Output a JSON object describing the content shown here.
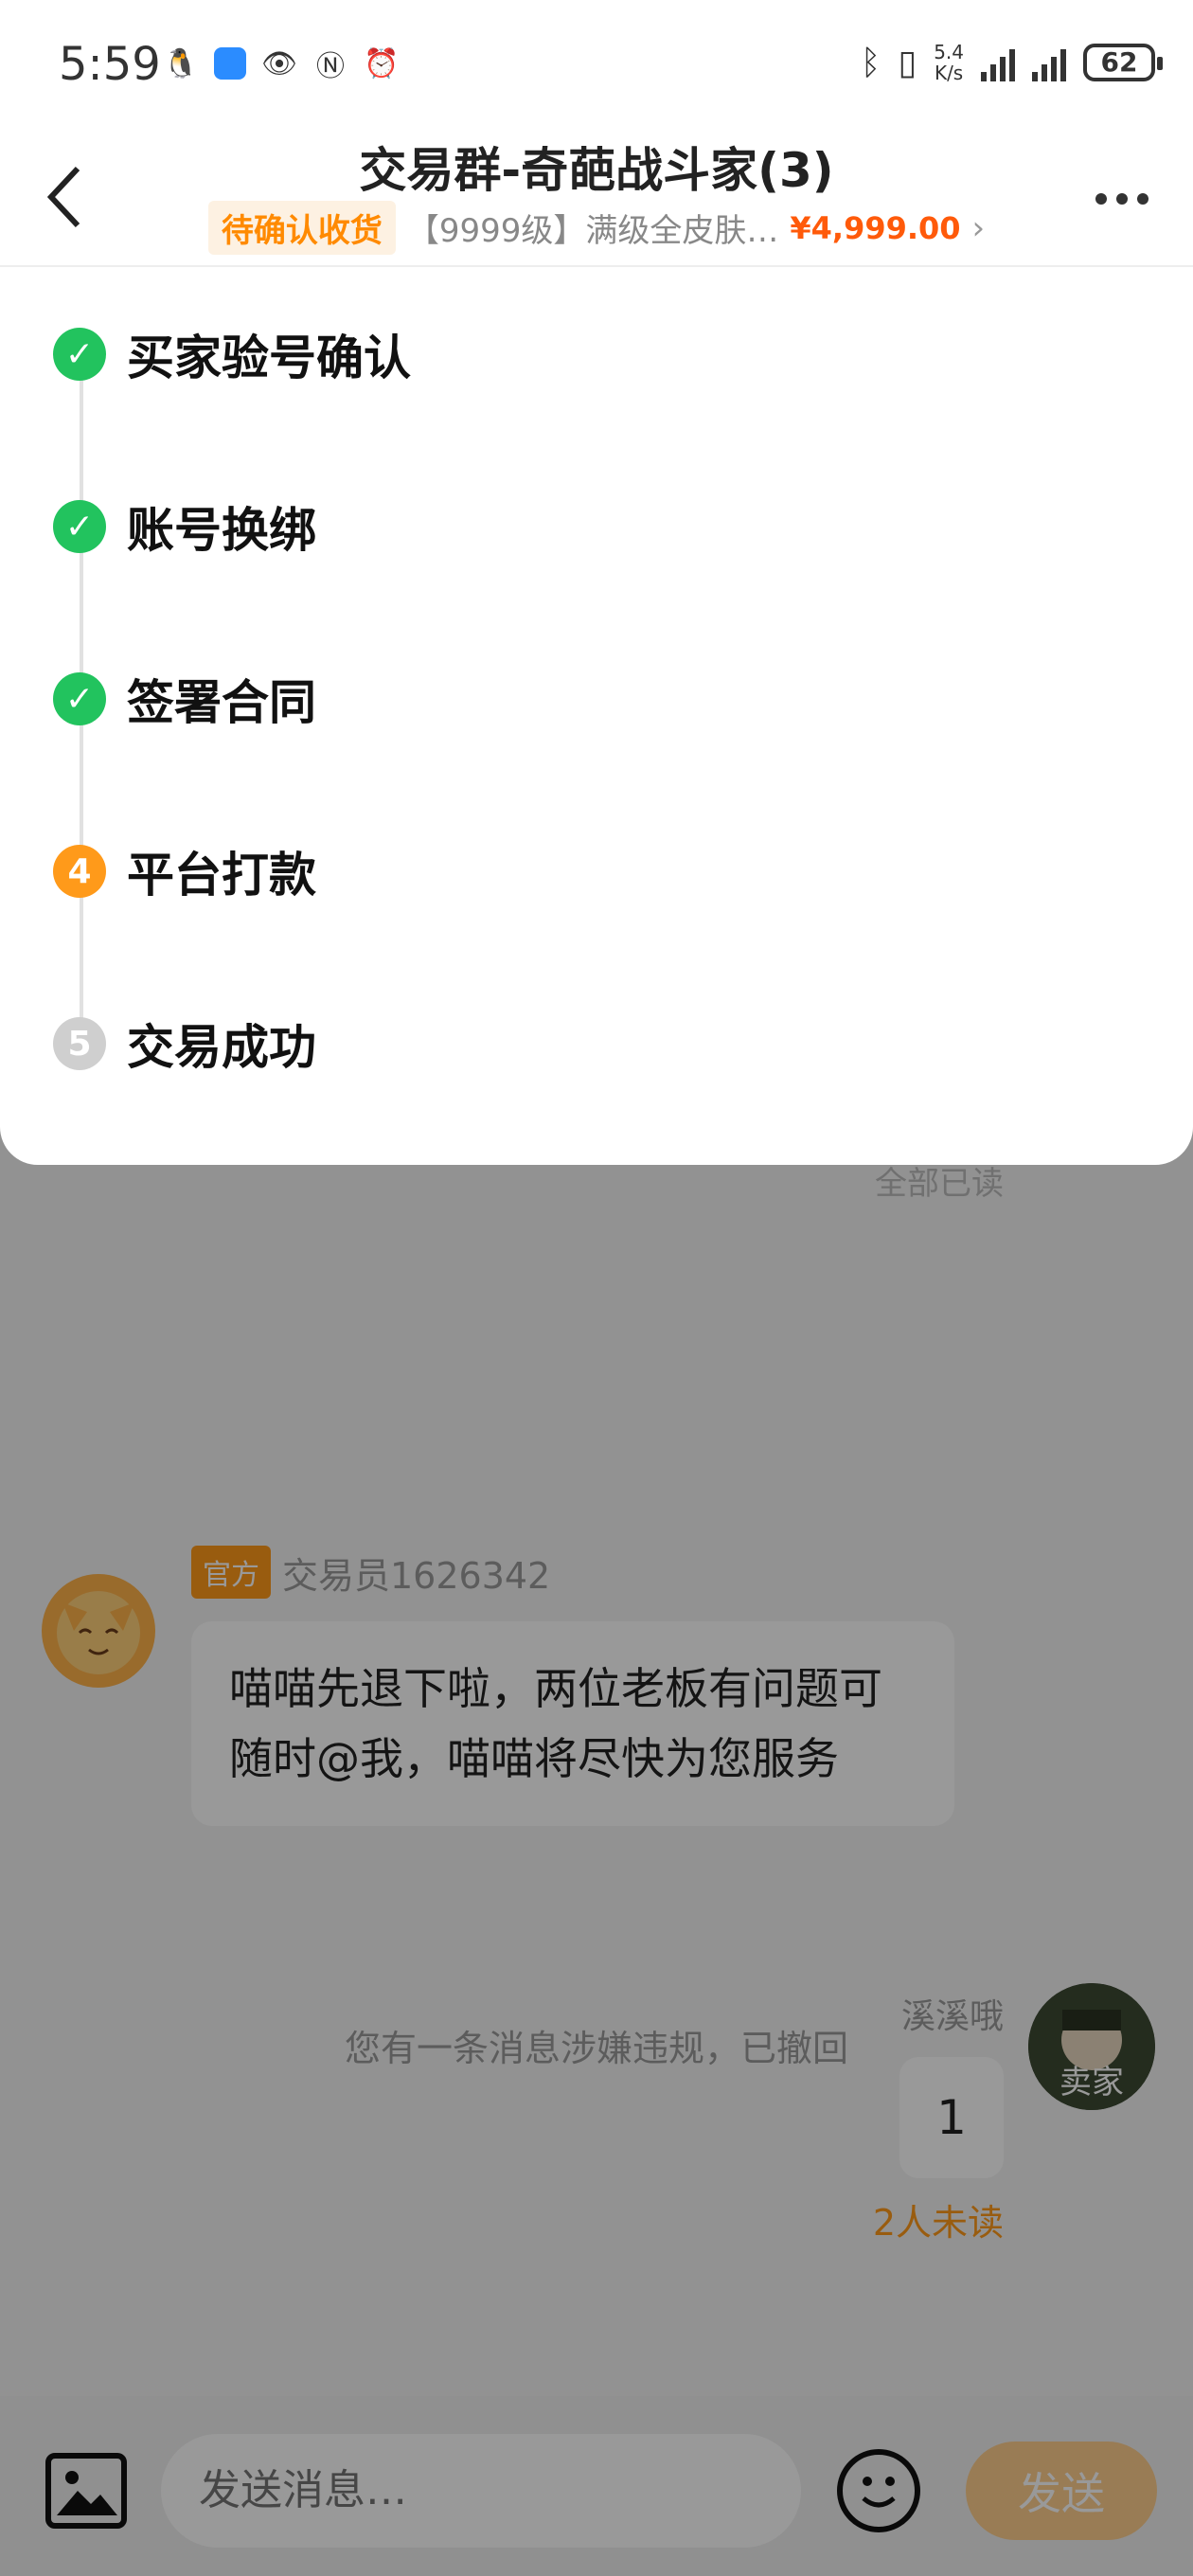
{
  "status_bar": {
    "time": "5:59",
    "network_speed": "5.4\nK/s",
    "battery": "62"
  },
  "header": {
    "title": "交易群-奇葩战斗家(3)",
    "order_status": "待确认收货",
    "product": "【9999级】满级全皮肤…",
    "price": "¥4,999.00"
  },
  "steps": [
    {
      "label": "买家验号确认",
      "state": "done"
    },
    {
      "label": "账号换绑",
      "state": "done"
    },
    {
      "label": "签署合同",
      "state": "done"
    },
    {
      "label": "平台打款",
      "state": "current",
      "number": "4"
    },
    {
      "label": "交易成功",
      "state": "pending",
      "number": "5"
    }
  ],
  "chat": {
    "all_read": "全部已读",
    "official_tag": "官方",
    "sender_name": "交易员1626342",
    "official_message": "喵喵先退下啦，两位老板有问题可随时@我，喵喵将尽快为您服务",
    "seller_name": "溪溪哦",
    "seller_avatar_label": "卖家",
    "seller_message": "1",
    "unread_status": "2人未读",
    "revoked_notice": "您有一条消息涉嫌违规，已撤回"
  },
  "input_bar": {
    "placeholder": "发送消息…",
    "send_label": "发送"
  },
  "colors": {
    "accent_orange": "#ff9a1a",
    "price_orange": "#ff5a0a",
    "success_green": "#22c35e"
  }
}
